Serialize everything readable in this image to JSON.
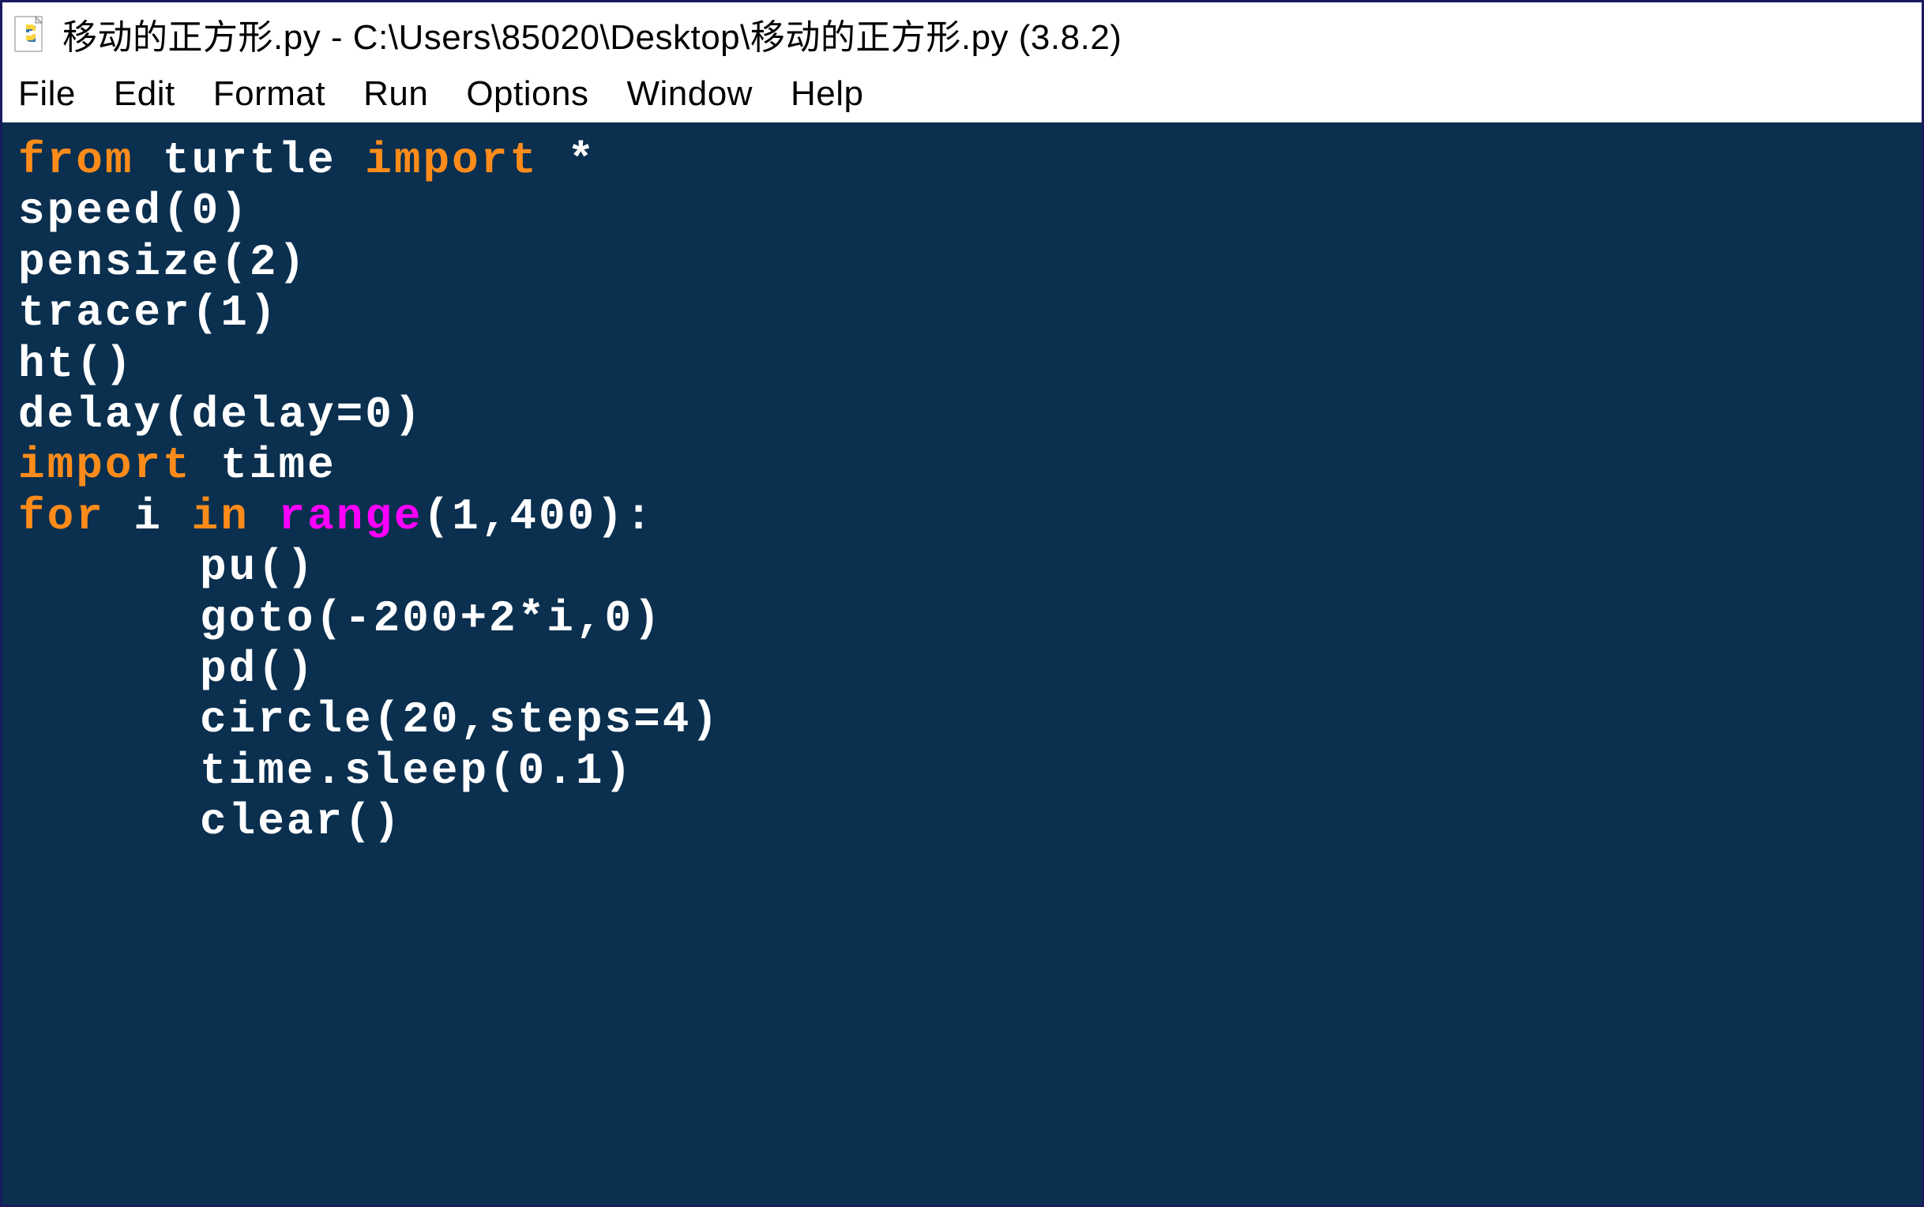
{
  "window": {
    "title": "移动的正方形.py - C:\\Users\\85020\\Desktop\\移动的正方形.py (3.8.2)"
  },
  "menu": {
    "file": "File",
    "edit": "Edit",
    "format": "Format",
    "run": "Run",
    "options": "Options",
    "window": "Window",
    "help": "Help"
  },
  "code": {
    "line1": {
      "kw1": "from",
      "txt1": " turtle ",
      "kw2": "import",
      "txt2": " *"
    },
    "line2": "speed(0)",
    "line3": "pensize(2)",
    "line4": "tracer(1)",
    "line5": "ht()",
    "line6": "delay(delay=0)",
    "line7": {
      "kw1": "import",
      "txt1": " time"
    },
    "line8": {
      "kw1": "for",
      "txt1": " i ",
      "kw2": "in",
      "txt2": " ",
      "fn": "range",
      "txt3": "(1,400):"
    },
    "line9": "pu()",
    "line10": "goto(-200+2*i,0)",
    "line11": "pd()",
    "line12": "circle(20,steps=4)",
    "line13": "time.sleep(0.1)",
    "line14": "clear()"
  }
}
